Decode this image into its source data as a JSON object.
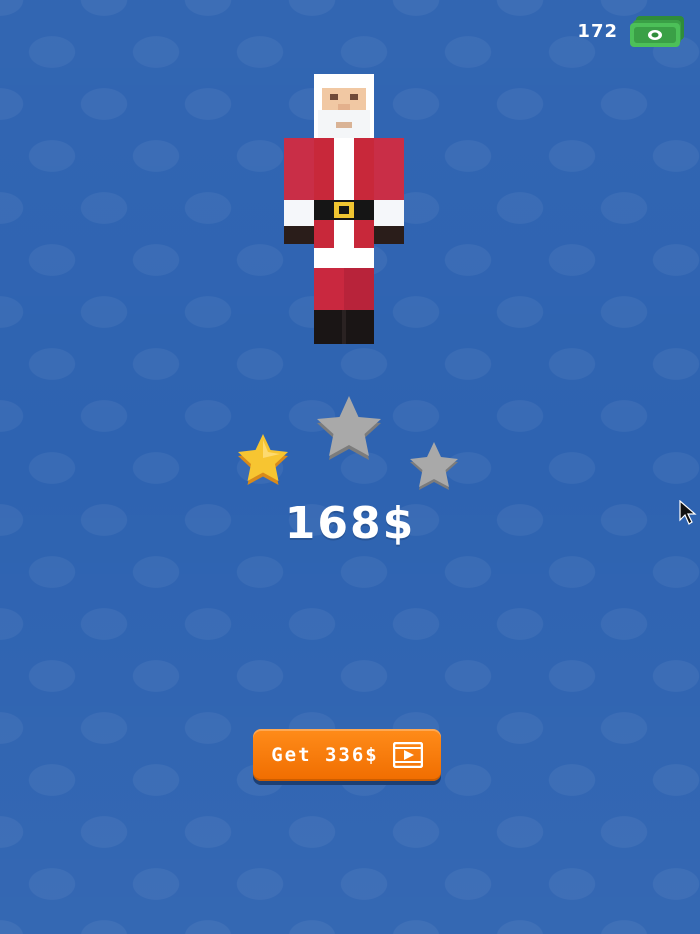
{
  "hud": {
    "currency_amount": "172",
    "currency_icon": "cash-stack-icon"
  },
  "character": {
    "icon": "santa-skin-character"
  },
  "rating": {
    "earned_stars": 1,
    "total_stars": 3
  },
  "reward": {
    "price": "168$"
  },
  "get_button": {
    "label": "Get 336$",
    "icon": "video-ad-icon"
  },
  "colors": {
    "background": "#2e63b1",
    "button": "#f27400",
    "star_gold": "#f7c531",
    "star_grey": "#a6a6a6",
    "cash_green": "#3fae4a"
  }
}
